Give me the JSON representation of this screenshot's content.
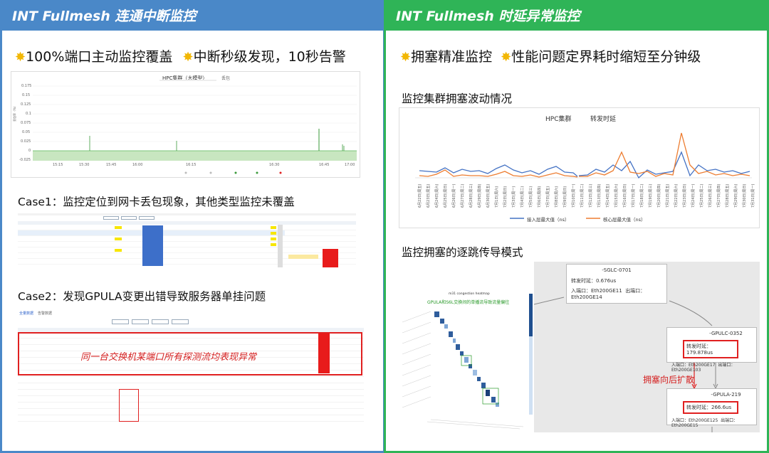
{
  "left": {
    "title": "INT Fullmesh 连通中断监控",
    "headline_a": "100%端口主动监控覆盖",
    "headline_b": "中断秒级发现，10秒告警",
    "chart1": {
      "title": "HPC集群（大模型）",
      "sub_tab": "丢包",
      "yticks": [
        "0.175",
        "0.15",
        "0.125",
        "0.1",
        "0.075",
        "0.05",
        "0.025",
        "0",
        "-0.025"
      ],
      "xticks": [
        "15:15",
        "15:30",
        "15:45",
        "16:00",
        "16:15",
        "16:30",
        "16:45",
        "17:00"
      ]
    },
    "case1": "Case1：监控定位到网卡丢包现象，其他类型监控未覆盖",
    "case2": "Case2：发现GPULA变更出错导致服务器单挂问题",
    "case2_note": "同一台交换机某端口所有探测流均表现异常",
    "case2_tabs": [
      "全量数据",
      "告警数据"
    ]
  },
  "right": {
    "title": "INT Fullmesh 时延异常监控",
    "headline_a": "拥塞精准监控",
    "headline_b": "性能问题定界耗时缩短至分钟级",
    "sec1": "监控集群拥塞波动情况",
    "chart2": {
      "title": "HPC集群",
      "subtitle": "转发时延",
      "legend": [
        "接入层最大值（ns）",
        "核心层最大值（ns）"
      ],
      "colors": [
        "#4472c4",
        "#ed7d31"
      ]
    },
    "sec2": "监控拥塞的逐跳传导模式",
    "heatmap_title": "m31 congestion heatmap",
    "heatmap_note": "GPULA和S6L交换间的单播流导致流量偏往",
    "spread": "拥塞向后扩散",
    "nodes": [
      {
        "name": "-SGLC-0701",
        "delay": "转发时延：0.676us",
        "in": "入端口：Eth200GE11",
        "out": "出端口：Eth200GE14"
      },
      {
        "name": "-GPULC-0352",
        "delay": "转发时延：179.878us",
        "in": "入端口：Eth200GE17",
        "out": "出端口：Eth200GE103"
      },
      {
        "name": "-GPULA-219",
        "delay": "转发时延：266.6us",
        "in": "入端口：Eth200GE125",
        "out": "出端口：Eth200GE15"
      }
    ]
  }
}
